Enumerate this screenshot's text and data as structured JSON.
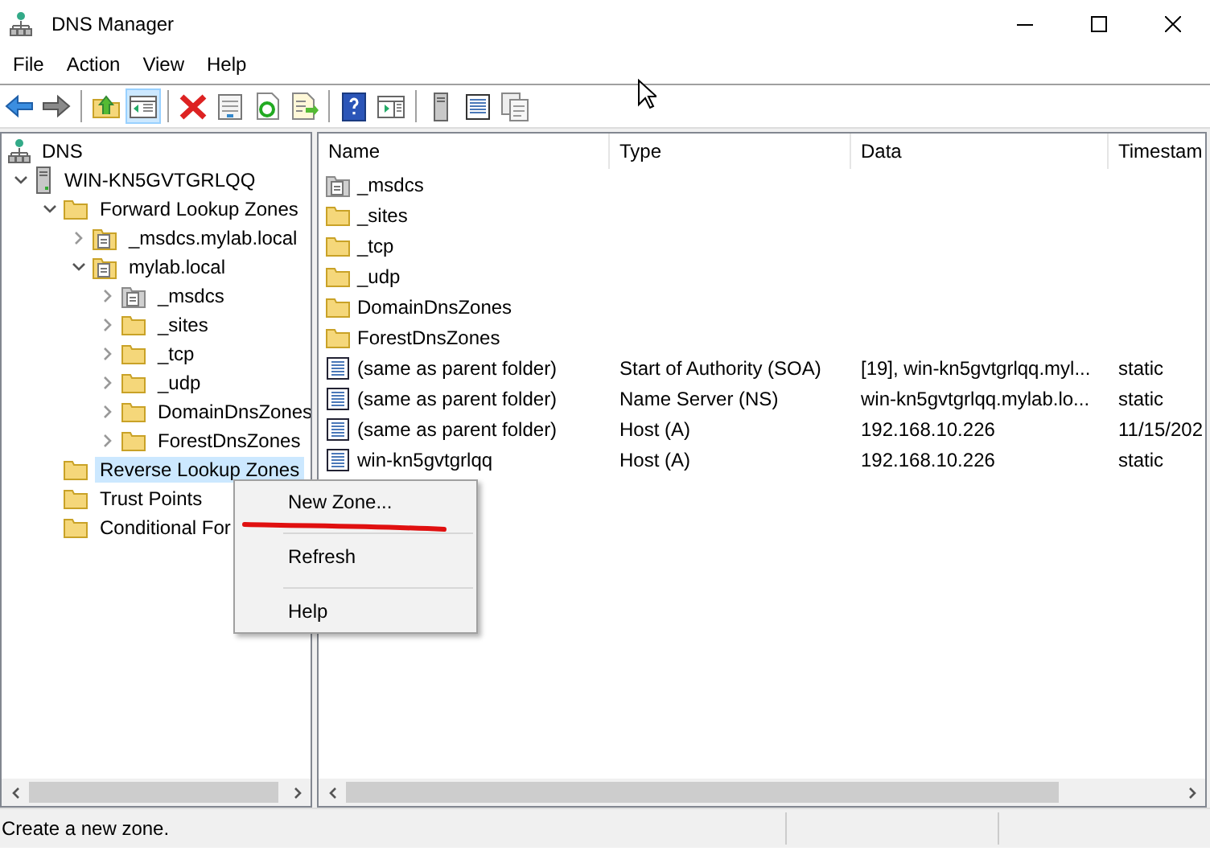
{
  "window": {
    "title": "DNS Manager"
  },
  "menu_bar": [
    "File",
    "Action",
    "View",
    "Help"
  ],
  "toolbar": [
    {
      "kind": "back",
      "selected": false
    },
    {
      "kind": "forward",
      "selected": false
    },
    {
      "kind": "separator"
    },
    {
      "kind": "up",
      "selected": false
    },
    {
      "kind": "tree-toggle",
      "selected": true
    },
    {
      "kind": "separator"
    },
    {
      "kind": "delete",
      "selected": false
    },
    {
      "kind": "properties",
      "selected": false
    },
    {
      "kind": "refresh",
      "selected": false
    },
    {
      "kind": "export",
      "selected": false
    },
    {
      "kind": "separator"
    },
    {
      "kind": "help",
      "selected": false
    },
    {
      "kind": "action-pane",
      "selected": false
    },
    {
      "kind": "separator"
    },
    {
      "kind": "server",
      "selected": false
    },
    {
      "kind": "list",
      "selected": false
    },
    {
      "kind": "copy",
      "selected": false
    }
  ],
  "tree": [
    {
      "label": "DNS",
      "kind": "dns",
      "selected": false,
      "children": [
        {
          "label": "WIN-KN5GVTGRLQQ",
          "kind": "server",
          "selected": false,
          "expanded": true,
          "children": [
            {
              "label": "Forward Lookup Zones",
              "kind": "folder",
              "selected": false,
              "expanded": true,
              "children": [
                {
                  "label": "_msdcs.mylab.local",
                  "kind": "zone",
                  "selected": false,
                  "expanded": false
                },
                {
                  "label": "mylab.local",
                  "kind": "zone",
                  "selected": false,
                  "expanded": true,
                  "children": [
                    {
                      "label": "_msdcs",
                      "kind": "zone-grey",
                      "selected": false,
                      "expanded": false
                    },
                    {
                      "label": "_sites",
                      "kind": "folder",
                      "selected": false,
                      "expanded": false
                    },
                    {
                      "label": "_tcp",
                      "kind": "folder",
                      "selected": false,
                      "expanded": false
                    },
                    {
                      "label": "_udp",
                      "kind": "folder",
                      "selected": false,
                      "expanded": false
                    },
                    {
                      "label": "DomainDnsZones",
                      "kind": "folder",
                      "selected": false,
                      "expanded": false
                    },
                    {
                      "label": "ForestDnsZones",
                      "kind": "folder",
                      "selected": false,
                      "expanded": false
                    }
                  ]
                }
              ]
            },
            {
              "label": "Reverse Lookup Zones",
              "kind": "folder",
              "selected": true
            },
            {
              "label": "Trust Points",
              "kind": "folder",
              "selected": false
            },
            {
              "label": "Conditional For",
              "kind": "folder",
              "selected": false
            }
          ]
        }
      ]
    }
  ],
  "list": {
    "columns": [
      "Name",
      "Type",
      "Data",
      "Timestam"
    ],
    "rows": [
      {
        "kind": "zone-grey",
        "cells": [
          "_msdcs"
        ]
      },
      {
        "kind": "folder",
        "cells": [
          "_sites"
        ]
      },
      {
        "kind": "folder",
        "cells": [
          "_tcp"
        ]
      },
      {
        "kind": "folder",
        "cells": [
          "_udp"
        ]
      },
      {
        "kind": "folder",
        "cells": [
          "DomainDnsZones"
        ]
      },
      {
        "kind": "folder",
        "cells": [
          "ForestDnsZones"
        ]
      },
      {
        "kind": "record",
        "cells": [
          "(same as parent folder)",
          "Start of Authority (SOA)",
          "[19], win-kn5gvtgrlqq.myl...",
          "static"
        ]
      },
      {
        "kind": "record",
        "cells": [
          "(same as parent folder)",
          "Name Server (NS)",
          "win-kn5gvtgrlqq.mylab.lo...",
          "static"
        ]
      },
      {
        "kind": "record",
        "cells": [
          "(same as parent folder)",
          "Host (A)",
          "192.168.10.226",
          "11/15/202"
        ]
      },
      {
        "kind": "record",
        "cells": [
          "win-kn5gvtgrlqq",
          "Host (A)",
          "192.168.10.226",
          "static"
        ]
      }
    ]
  },
  "context_menu": [
    {
      "kind": "item",
      "label": "New Zone..."
    },
    {
      "kind": "separator"
    },
    {
      "kind": "item",
      "label": "Refresh"
    },
    {
      "kind": "separator"
    },
    {
      "kind": "item",
      "label": "Help"
    }
  ],
  "status_bar": {
    "text": "Create a new zone."
  }
}
